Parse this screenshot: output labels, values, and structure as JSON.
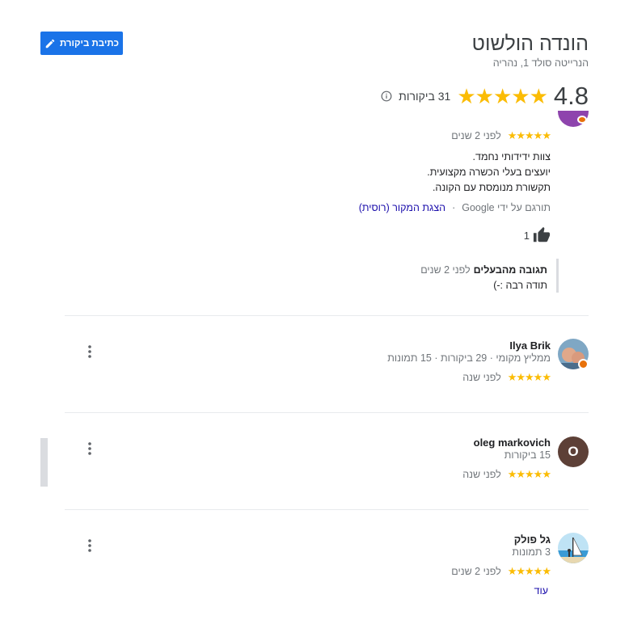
{
  "header": {
    "write_review_label": "כתיבת ביקורת",
    "title": "הונדה הולשוט",
    "address": "הנרייטה סולד 1, נהריה",
    "rating": "4.8",
    "stars": "★★★★★",
    "review_count": "31 ביקורות"
  },
  "first_review": {
    "stars": "★★★★★",
    "time": "לפני 2 שנים",
    "lines": [
      "צוות ידידותי נחמד.",
      "יועצים בעלי הכשרה מקצועית.",
      "תקשורת מנומסת עם הקונה."
    ],
    "translated_by": "תורגם על ידי Google",
    "separator": "·",
    "show_original": "הצגת המקור (רוסית)",
    "likes": "1",
    "owner_reply_label": "תגובה מהבעלים",
    "owner_reply_time": "לפני 2 שנים",
    "owner_reply_text": "תודה רבה :-)"
  },
  "reviews": [
    {
      "name": "Ilya Brik",
      "meta": "ממליץ מקומי · 29 ביקורות · 15 תמונות",
      "stars": "★★★★★",
      "time": "לפני שנה"
    },
    {
      "name": "oleg markovich",
      "meta": "15 ביקורות",
      "stars": "★★★★★",
      "time": "לפני שנה",
      "avatar_letter": "O"
    },
    {
      "name": "גל פולק",
      "meta": "3 תמונות",
      "stars": "★★★★★",
      "time": "לפני 2 שנים",
      "more_link": "עוד"
    }
  ],
  "colors": {
    "accent": "#1a73e8",
    "star": "#fbbc04",
    "avatar_o": "#5d4037"
  }
}
